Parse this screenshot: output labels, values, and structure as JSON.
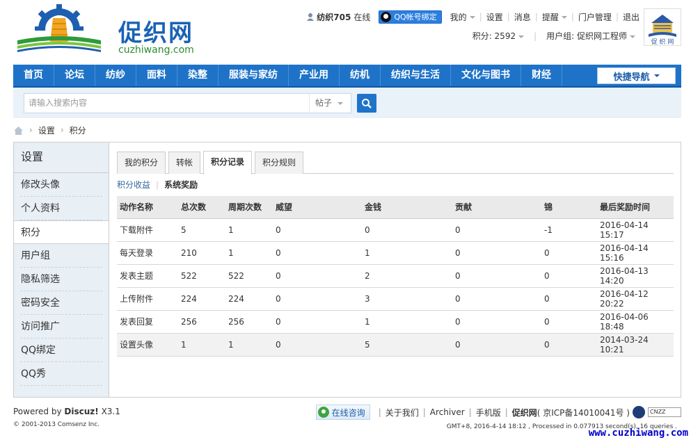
{
  "logo": {
    "name": "促织网",
    "domain": "cuzhiwang.com"
  },
  "user": {
    "name": "纺织705",
    "status": "在线",
    "qq_bind": "QQ帐号绑定",
    "menu": [
      "我的",
      "设置",
      "消息",
      "提醒",
      "门户管理",
      "退出"
    ],
    "points_label": "积分: 2592",
    "group_label": "用户组: 促织网工程师"
  },
  "nav": {
    "items": [
      "首页",
      "论坛",
      "纺纱",
      "面料",
      "染整",
      "服装与家纺",
      "产业用",
      "纺机",
      "纺织与生活",
      "文化与图书",
      "财经"
    ],
    "quick": "快捷导航"
  },
  "search": {
    "placeholder": "请输入搜索内容",
    "type": "帖子"
  },
  "breadcrumb": [
    "设置",
    "积分"
  ],
  "sidebar": {
    "title": "设置",
    "items": [
      "修改头像",
      "个人资料",
      "积分",
      "用户组",
      "隐私筛选",
      "密码安全",
      "访问推广",
      "QQ绑定",
      "QQ秀"
    ],
    "active": "积分"
  },
  "tabs": [
    "我的积分",
    "转帐",
    "积分记录",
    "积分规则"
  ],
  "active_tab": "积分记录",
  "subtabs": {
    "link": "积分收益",
    "current": "系统奖励"
  },
  "table": {
    "headers": [
      "动作名称",
      "总次数",
      "周期次数",
      "威望",
      "金钱",
      "贡献",
      "锦",
      "最后奖励时间"
    ],
    "rows": [
      [
        "下载附件",
        "5",
        "1",
        "0",
        "0",
        "0",
        "-1",
        "2016-04-14 15:17"
      ],
      [
        "每天登录",
        "210",
        "1",
        "0",
        "1",
        "0",
        "0",
        "2016-04-14 15:16"
      ],
      [
        "发表主题",
        "522",
        "522",
        "0",
        "2",
        "0",
        "0",
        "2016-04-13 14:20"
      ],
      [
        "上传附件",
        "224",
        "224",
        "0",
        "3",
        "0",
        "0",
        "2016-04-12 20:22"
      ],
      [
        "发表回复",
        "256",
        "256",
        "0",
        "1",
        "0",
        "0",
        "2016-04-06 18:48"
      ],
      [
        "设置头像",
        "1",
        "1",
        "0",
        "5",
        "0",
        "0",
        "2014-03-24 10:21"
      ]
    ]
  },
  "footer": {
    "powered_prefix": "Powered by",
    "powered_brand": "Discuz!",
    "powered_version": "X3.1",
    "copyright": "© 2001-2013 Comsenz Inc.",
    "consult": "在线咨询",
    "links": [
      "关于我们",
      "Archiver",
      "手机版"
    ],
    "site": "促织网",
    "icp": "( 京ICP备14010041号 )",
    "badge": "CNZZ",
    "gmt": "GMT+8, 2016-4-14 18:12 , Processed in 0.077913 second(s), 16 queries .",
    "watermark": "www.cuzhiwang.com"
  },
  "colors": {
    "nav": "#1e73c8",
    "search_bg": "#e9f1f9",
    "sidebar_bg": "#e8eff5"
  }
}
